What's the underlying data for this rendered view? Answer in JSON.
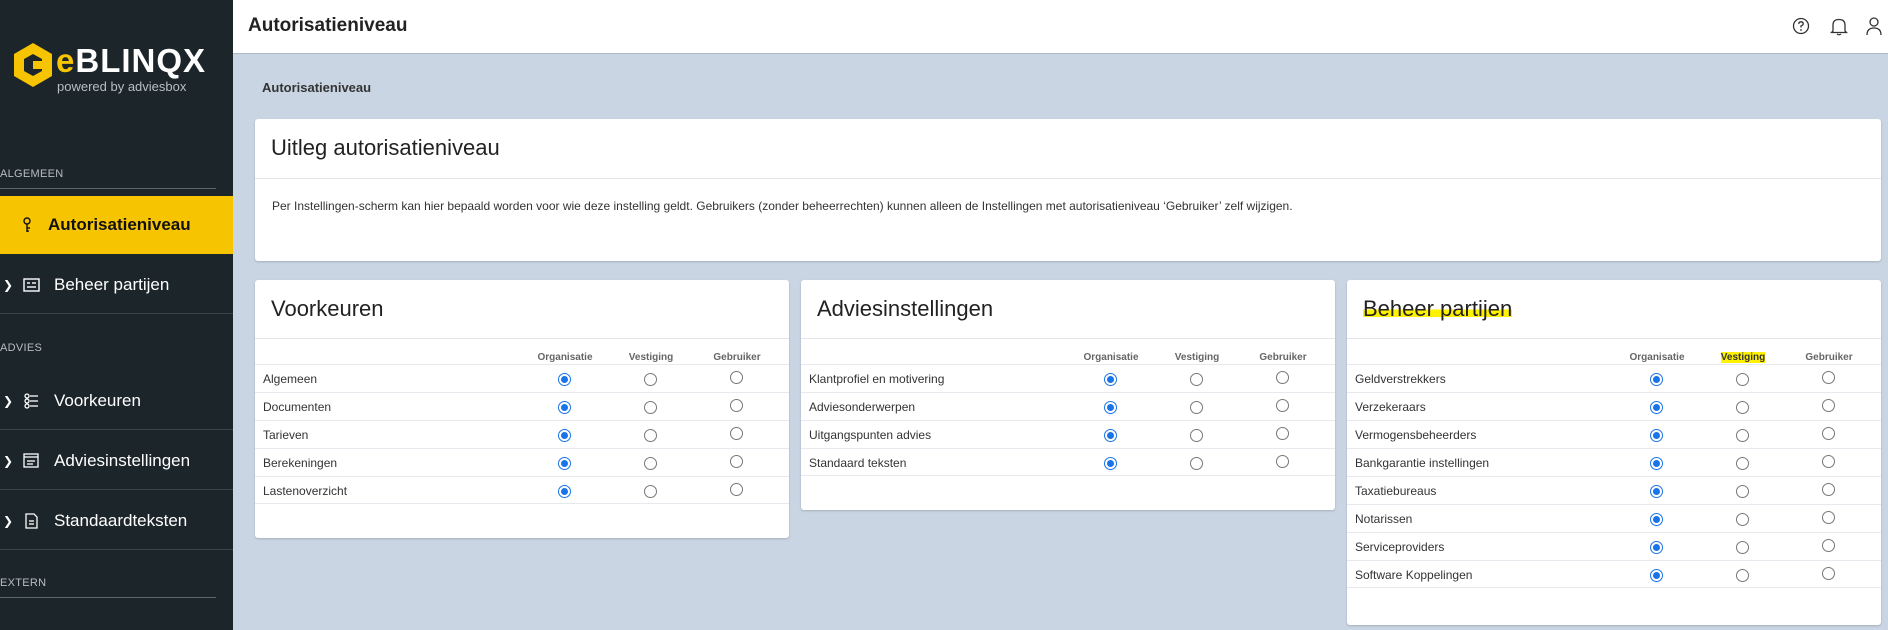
{
  "brand": {
    "logo_text": "BLINQX",
    "logo_letter": "e",
    "tagline": "powered by adviesbox",
    "accent": "#f6c400"
  },
  "sidebar": {
    "sections": [
      {
        "label": "ALGEMEEN"
      },
      {
        "label": "ADVIES"
      },
      {
        "label": "EXTERN"
      }
    ],
    "items": [
      {
        "label": "Autorisatieniveau",
        "icon": "key-icon",
        "active": true
      },
      {
        "label": "Beheer partijen",
        "icon": "id-card-icon"
      },
      {
        "label": "Voorkeuren",
        "icon": "sliders-icon"
      },
      {
        "label": "Adviesinstellingen",
        "icon": "list-settings-icon"
      },
      {
        "label": "Standaardteksten",
        "icon": "document-icon"
      }
    ]
  },
  "header": {
    "title": "Autorisatieniveau",
    "icons": [
      "help-icon",
      "bell-icon",
      "user-icon"
    ]
  },
  "breadcrumb": "Autorisatieniveau",
  "uitleg": {
    "title": "Uitleg autorisatieniveau",
    "text": "Per Instellingen-scherm kan hier bepaald worden voor wie deze instelling geldt. Gebruikers (zonder beheerrechten) kunnen alleen de Instellingen met autorisatieniveau ‘Gebruiker’ zelf wijzigen."
  },
  "columns": [
    "Organisatie",
    "Vestiging",
    "Gebruiker"
  ],
  "panels": [
    {
      "title": "Voorkeuren",
      "rows": [
        {
          "label": "Algemeen",
          "selected": 0
        },
        {
          "label": "Documenten",
          "selected": 0
        },
        {
          "label": "Tarieven",
          "selected": 0
        },
        {
          "label": "Berekeningen",
          "selected": 0
        },
        {
          "label": "Lastenoverzicht",
          "selected": 0
        }
      ]
    },
    {
      "title": "Adviesinstellingen",
      "rows": [
        {
          "label": "Klantprofiel en motivering",
          "selected": 0
        },
        {
          "label": "Adviesonderwerpen",
          "selected": 0
        },
        {
          "label": "Uitgangspunten advies",
          "selected": 0
        },
        {
          "label": "Standaard teksten",
          "selected": 0
        }
      ]
    },
    {
      "title": "Beheer partijen",
      "rows": [
        {
          "label": "Geldverstrekkers",
          "selected": 0
        },
        {
          "label": "Verzekeraars",
          "selected": 0
        },
        {
          "label": "Vermogensbeheerders",
          "selected": 0
        },
        {
          "label": "Bankgarantie instellingen",
          "selected": 0
        },
        {
          "label": "Taxatiebureaus",
          "selected": 0
        },
        {
          "label": "Notarissen",
          "selected": 0
        },
        {
          "label": "Serviceproviders",
          "selected": 0
        },
        {
          "label": "Software Koppelingen",
          "selected": 0
        }
      ]
    }
  ]
}
